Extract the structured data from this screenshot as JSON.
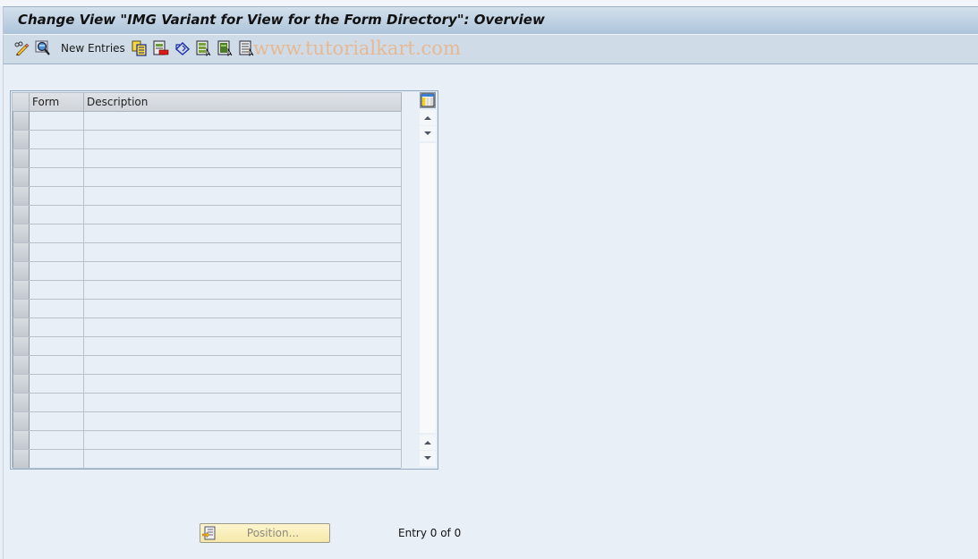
{
  "window": {
    "title": "Change View \"IMG Variant for View for the Form Directory\": Overview"
  },
  "toolbar": {
    "items": [
      {
        "icon": "display-change-icon",
        "tooltip": ""
      },
      {
        "icon": "find-icon",
        "tooltip": ""
      },
      {
        "label": "New Entries"
      },
      {
        "icon": "copy-as-icon"
      },
      {
        "icon": "delete-icon"
      },
      {
        "icon": "undo-change-icon"
      },
      {
        "icon": "select-all-icon"
      },
      {
        "icon": "select-block-icon"
      },
      {
        "icon": "deselect-all-icon"
      }
    ],
    "new_entries_label": "New Entries",
    "watermark": "www.tutorialkart.com"
  },
  "table": {
    "columns": [
      {
        "key": "form",
        "label": "Form"
      },
      {
        "key": "description",
        "label": "Description"
      }
    ],
    "rows": [
      {
        "form": "",
        "description": ""
      },
      {
        "form": "",
        "description": ""
      },
      {
        "form": "",
        "description": ""
      },
      {
        "form": "",
        "description": ""
      },
      {
        "form": "",
        "description": ""
      },
      {
        "form": "",
        "description": ""
      },
      {
        "form": "",
        "description": ""
      },
      {
        "form": "",
        "description": ""
      },
      {
        "form": "",
        "description": ""
      },
      {
        "form": "",
        "description": ""
      },
      {
        "form": "",
        "description": ""
      },
      {
        "form": "",
        "description": ""
      },
      {
        "form": "",
        "description": ""
      },
      {
        "form": "",
        "description": ""
      },
      {
        "form": "",
        "description": ""
      },
      {
        "form": "",
        "description": ""
      },
      {
        "form": "",
        "description": ""
      },
      {
        "form": "",
        "description": ""
      },
      {
        "form": "",
        "description": ""
      }
    ]
  },
  "footer": {
    "position_button_label": "Position...",
    "entry_count": "Entry 0 of 0"
  },
  "colors": {
    "background": "#e9eff7",
    "titlebar_top": "#d3e0ec",
    "titlebar_bottom": "#adc4da",
    "toolbar": "#cfdce7",
    "position_button": "#f6e8a8",
    "watermark": "#e9b58a"
  }
}
